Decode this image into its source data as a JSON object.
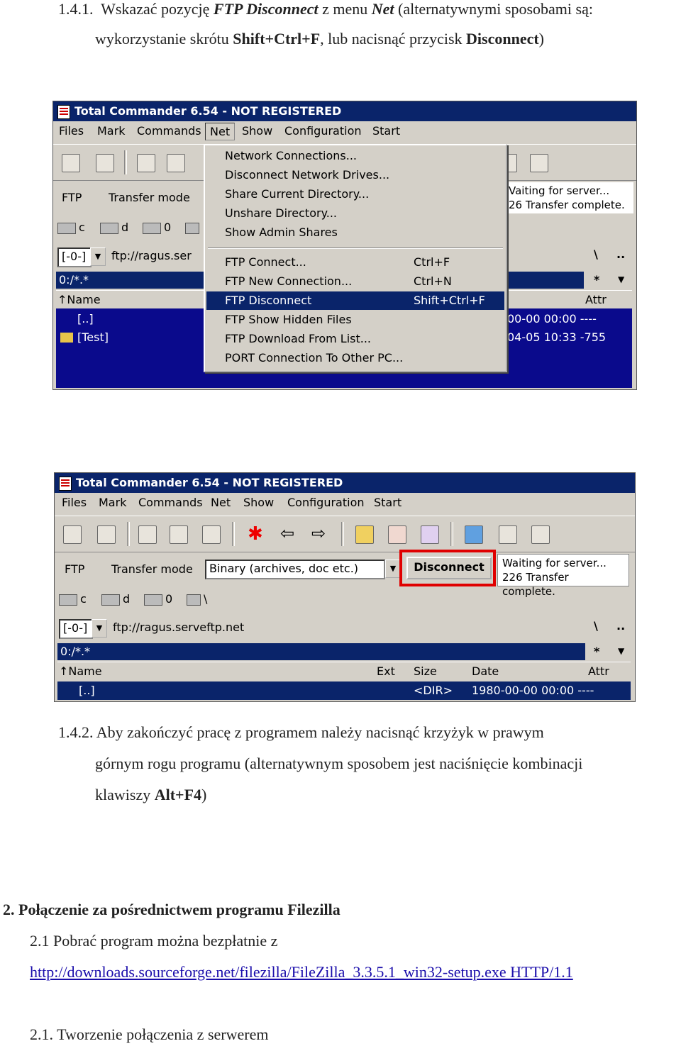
{
  "step141": {
    "num": "1.4.1.",
    "pre": "Wskazać pozycję",
    "em1": "FTP Disconnect",
    "mid": "z menu",
    "em2": "Net",
    "post": "(alternatywnymi sposobami są:",
    "line2a": "wykorzystanie skrótu",
    "key1": "Shift+Ctrl+F",
    "line2b": ", lub nacisnąć przycisk",
    "btnname": "Disconnect",
    "line2c": ")"
  },
  "shot1": {
    "title": "Total Commander 6.54 - NOT REGISTERED",
    "menu": [
      "Files",
      "Mark",
      "Commands",
      "Net",
      "Show",
      "Configuration",
      "Start"
    ],
    "ftp_label": "FTP",
    "transfer_label": "Transfer mode",
    "status1": "Vaiting for server...",
    "status2": "26 Transfer complete.",
    "drive_c": "c",
    "drive_d": "d",
    "drive_0": "0",
    "combo": "[-0-]",
    "path": "ftp://ragus.ser",
    "panel_path": "0:/*.*",
    "col_name": "↑Name",
    "col_attr": "Attr",
    "row1": "[..]",
    "row2": "[Test]",
    "row1_right": "00-00 00:00 ----",
    "row2_right": "04-05 10:33 -755",
    "backslash": "\\",
    "dotdot": "..",
    "star": "*",
    "net_menu": [
      {
        "label": "Network Connections...",
        "shortcut": ""
      },
      {
        "label": "Disconnect Network Drives...",
        "shortcut": ""
      },
      {
        "label": "Share Current Directory...",
        "shortcut": ""
      },
      {
        "label": "Unshare Directory...",
        "shortcut": ""
      },
      {
        "label": "Show Admin Shares",
        "shortcut": ""
      },
      {
        "label": "FTP Connect...",
        "shortcut": "Ctrl+F"
      },
      {
        "label": "FTP New Connection...",
        "shortcut": "Ctrl+N"
      },
      {
        "label": "FTP Disconnect",
        "shortcut": "Shift+Ctrl+F"
      },
      {
        "label": "FTP Show Hidden Files",
        "shortcut": ""
      },
      {
        "label": "FTP Download From List...",
        "shortcut": ""
      },
      {
        "label": "PORT Connection To Other PC...",
        "shortcut": ""
      }
    ]
  },
  "shot2": {
    "title": "Total Commander 6.54 - NOT REGISTERED",
    "menu": [
      "Files",
      "Mark",
      "Commands",
      "Net",
      "Show",
      "Configuration",
      "Start"
    ],
    "ftp_label": "FTP",
    "transfer_label": "Transfer mode",
    "transfer_value": "Binary (archives, doc etc.)",
    "disconnect": "Disconnect",
    "status1": "Waiting for server...",
    "status2": "226 Transfer complete.",
    "drive_c": "c",
    "drive_d": "d",
    "drive_0": "0",
    "drive_root": "\\",
    "combo": "[-0-]",
    "path": "ftp://ragus.serveftp.net",
    "panel_path": "0:/*.*",
    "col_name": "↑Name",
    "col_ext": "Ext",
    "col_size": "Size",
    "col_date": "Date",
    "col_attr": "Attr",
    "row1_name": "[..]",
    "row1_size": "<DIR>",
    "row1_date": "1980-00-00 00:00 ----",
    "backslash": "\\",
    "dotdot": "..",
    "star": "*"
  },
  "step142": {
    "l1": "1.4.2.   Aby zakończyć pracę z programem należy nacisnąć krzyżyk w prawym",
    "l2": "górnym rogu programu (alternatywnym sposobem jest naciśnięcie kombinacji",
    "l3a": "klawiszy ",
    "l3key": "Alt+F4",
    "l3b": ")"
  },
  "section2": {
    "heading": "2.  Połączenie za pośrednictwem programu Filezilla",
    "sub": "2.1 Pobrać program można bezpłatnie z",
    "link": "http://downloads.sourceforge.net/filezilla/FileZilla_3.3.5.1_win32-setup.exe HTTP/1.1",
    "sub2": "2.1. Tworzenie połączenia z serwerem"
  },
  "colors": {
    "highlight": "#e00000",
    "titlebar": "#0a246a",
    "panel": "#0a0a8c"
  }
}
